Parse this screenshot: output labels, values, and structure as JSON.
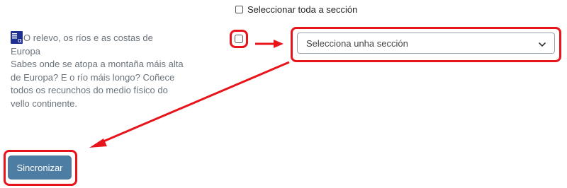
{
  "select_all": {
    "label": "Seleccionar toda a sección",
    "checked": false
  },
  "activity": {
    "icon": "page-resource-icon",
    "title": "O relevo, os ríos e as costas de Europa",
    "description": "Sabes onde se atopa a montaña máis alta de Europa? E o río máis longo? Coñece todos os recunchos do medio físico do vello continente.",
    "checked": false
  },
  "section_select": {
    "selected": "Selecciona unha sección"
  },
  "sync_button": {
    "label": "Sincronizar"
  },
  "colors": {
    "highlight": "#e8141c",
    "button_bg": "#4e7da3",
    "icon_bg": "#1f2f8f",
    "muted_text": "#6a737b"
  }
}
